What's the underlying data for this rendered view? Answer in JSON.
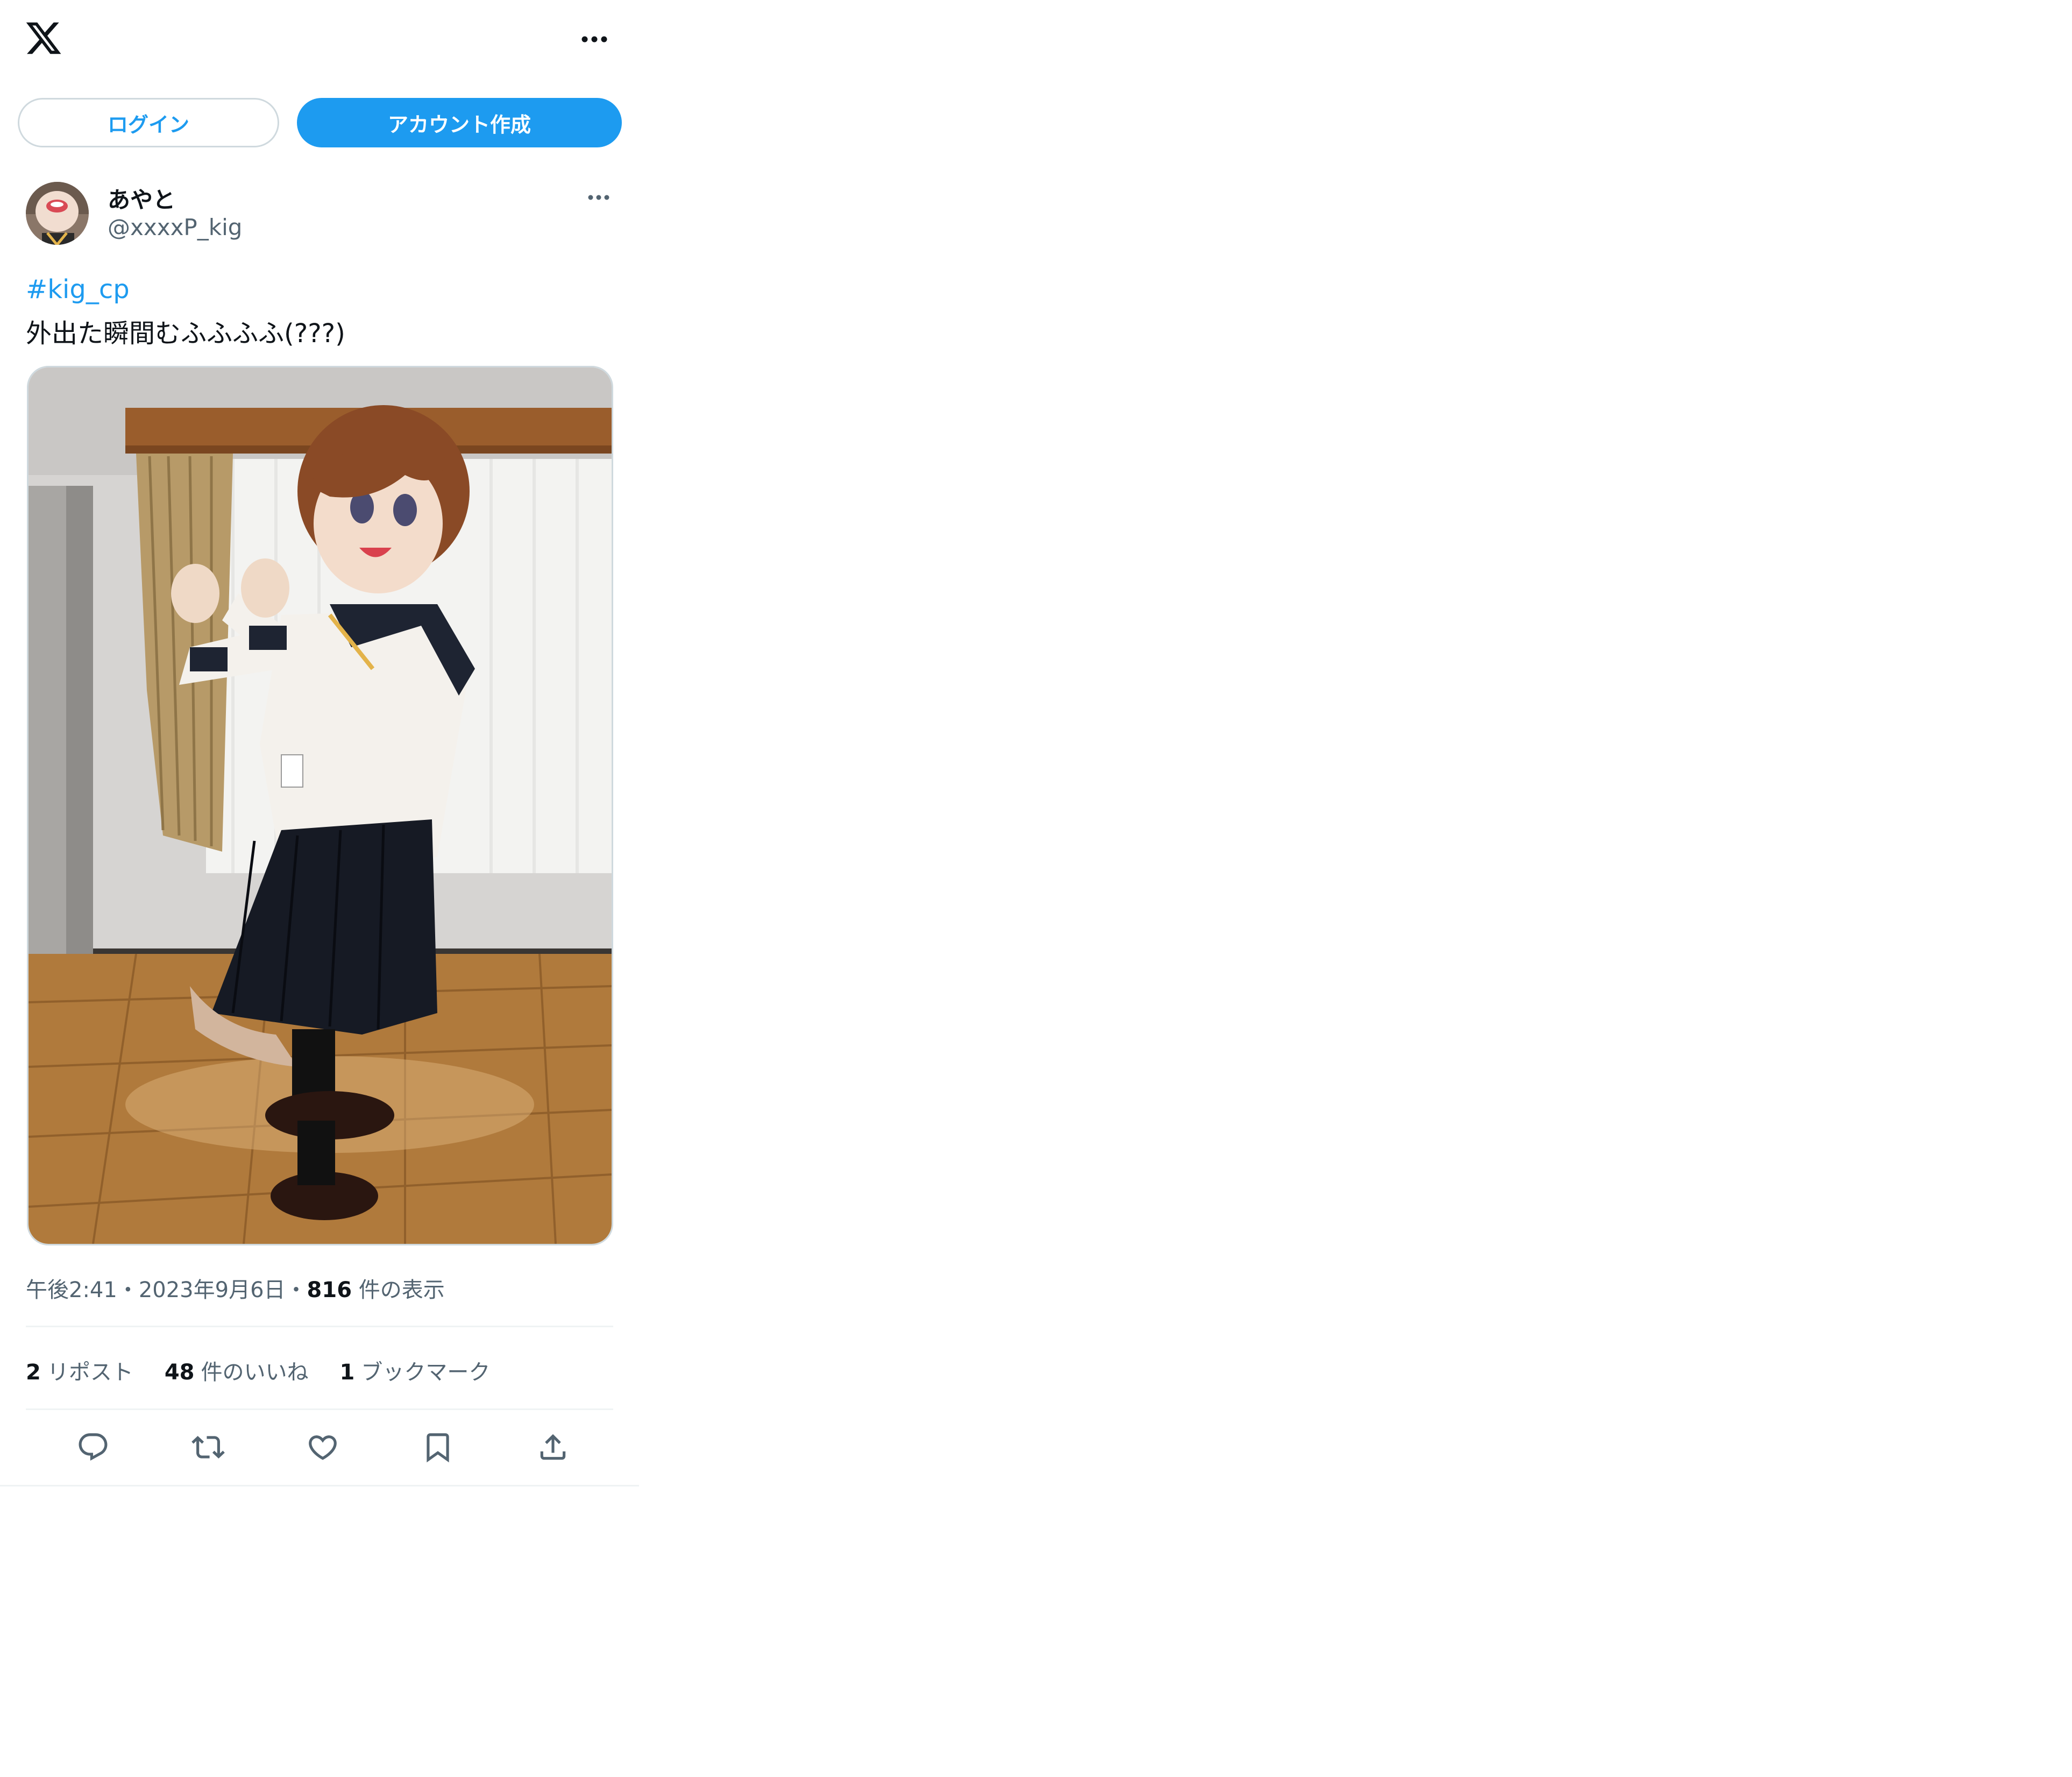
{
  "topbar": {
    "logo_icon": "x-logo-icon",
    "more_icon": "more-horizontal-icon"
  },
  "auth": {
    "login_label": "ログイン",
    "signup_label": "アカウント作成"
  },
  "tweet": {
    "author": {
      "display_name": "あやと",
      "handle": "@xxxxP_kig",
      "avatar_icon": "avatar"
    },
    "hashtag": "#kig_cp",
    "text": "外出た瞬間むふふふふ(???)",
    "meta": {
      "time": "午後2:41",
      "separator": "・",
      "date": "2023年9月6日",
      "views_count": "816",
      "views_label": "件の表示"
    },
    "stats": {
      "reposts_count": "2",
      "reposts_label": "リポスト",
      "likes_count": "48",
      "likes_label": "件のいいね",
      "bookmarks_count": "1",
      "bookmarks_label": "ブックマーク"
    },
    "actions": [
      "reply-icon",
      "repost-icon",
      "like-icon",
      "bookmark-icon",
      "share-icon"
    ]
  },
  "colors": {
    "accent": "#1d9bf0",
    "text": "#0f1419",
    "secondary_text": "#536471",
    "border": "#cfd9de",
    "divider": "#eff3f4"
  }
}
